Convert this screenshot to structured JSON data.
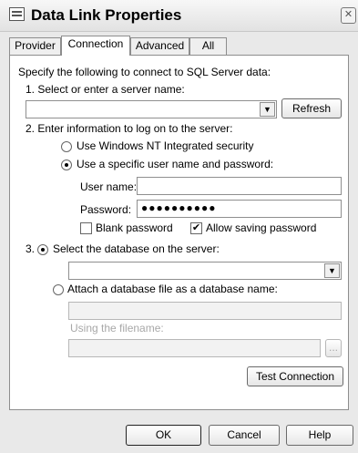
{
  "window": {
    "title": "Data Link Properties",
    "close_glyph": "✕"
  },
  "tabs": [
    {
      "label": "Provider"
    },
    {
      "label": "Connection"
    },
    {
      "label": "Advanced"
    },
    {
      "label": "All"
    }
  ],
  "connection": {
    "intro": "Specify the following to connect to SQL Server data:",
    "step1": "1. Select or enter a server name:",
    "server_value": "",
    "refresh_label": "Refresh",
    "step2": "2. Enter information to log on to the server:",
    "radio_nt": "Use Windows NT Integrated security",
    "radio_specific": "Use a specific user name and password:",
    "username_label": "User name:",
    "username_value": "",
    "password_label": "Password:",
    "password_value": "●●●●●●●●●●",
    "blank_password": "Blank password",
    "allow_saving": "Allow saving password",
    "step3_num": "3.",
    "radio_select_db": "Select the database on the server:",
    "database_value": "",
    "radio_attach": "Attach a database file as a database name:",
    "attach_value": "",
    "using_filename": "Using the filename:",
    "filename_value": "",
    "browse_label": "...",
    "test_connection": "Test Connection"
  },
  "footer": {
    "ok": "OK",
    "cancel": "Cancel",
    "help": "Help"
  }
}
